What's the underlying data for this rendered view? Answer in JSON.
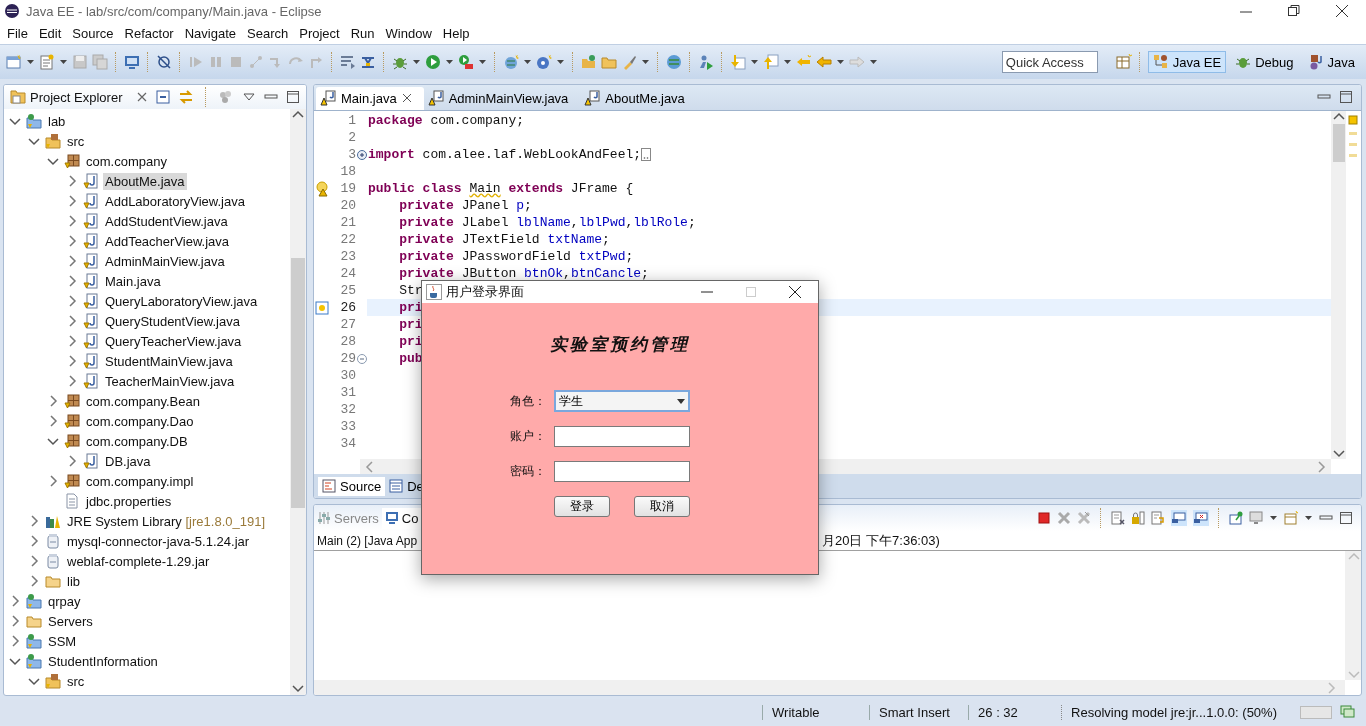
{
  "window": {
    "title": "Java EE - lab/src/com/company/Main.java - Eclipse"
  },
  "menu": [
    "File",
    "Edit",
    "Source",
    "Refactor",
    "Navigate",
    "Search",
    "Project",
    "Run",
    "Window",
    "Help"
  ],
  "toolbar": {
    "quick_access": {
      "placeholder": "Quick Access"
    },
    "perspectives": [
      {
        "label": "Java EE",
        "selected": true
      },
      {
        "label": "Debug",
        "selected": false
      },
      {
        "label": "Java",
        "selected": false
      }
    ]
  },
  "project_explorer": {
    "title": "Project Explorer",
    "tree": [
      {
        "label": "lab",
        "kind": "project",
        "expanded": true,
        "selected": false,
        "children": [
          {
            "label": "src",
            "kind": "src",
            "expanded": true,
            "selected": false,
            "children": [
              {
                "label": "com.company",
                "kind": "package",
                "expanded": true,
                "selected": false,
                "children": [
                  {
                    "label": "AboutMe.java",
                    "kind": "java",
                    "expanded": false,
                    "selected": true
                  },
                  {
                    "label": "AddLaboratoryView.java",
                    "kind": "java",
                    "expanded": false,
                    "selected": false
                  },
                  {
                    "label": "AddStudentView.java",
                    "kind": "java",
                    "expanded": false,
                    "selected": false
                  },
                  {
                    "label": "AddTeacherView.java",
                    "kind": "java",
                    "expanded": false,
                    "selected": false
                  },
                  {
                    "label": "AdminMainView.java",
                    "kind": "java",
                    "expanded": false,
                    "selected": false
                  },
                  {
                    "label": "Main.java",
                    "kind": "java",
                    "expanded": false,
                    "selected": false
                  },
                  {
                    "label": "QueryLaboratoryView.java",
                    "kind": "java",
                    "expanded": false,
                    "selected": false
                  },
                  {
                    "label": "QueryStudentView.java",
                    "kind": "java",
                    "expanded": false,
                    "selected": false
                  },
                  {
                    "label": "QueryTeacherView.java",
                    "kind": "java",
                    "expanded": false,
                    "selected": false
                  },
                  {
                    "label": "StudentMainView.java",
                    "kind": "java",
                    "expanded": false,
                    "selected": false
                  },
                  {
                    "label": "TeacherMainView.java",
                    "kind": "java",
                    "expanded": false,
                    "selected": false
                  }
                ]
              },
              {
                "label": "com.company.Bean",
                "kind": "package",
                "expanded": false,
                "selected": false
              },
              {
                "label": "com.company.Dao",
                "kind": "package",
                "expanded": false,
                "selected": false
              },
              {
                "label": "com.company.DB",
                "kind": "package",
                "expanded": true,
                "selected": false,
                "children": [
                  {
                    "label": "DB.java",
                    "kind": "java",
                    "expanded": false,
                    "selected": false
                  }
                ]
              },
              {
                "label": "com.company.impl",
                "kind": "package",
                "expanded": false,
                "selected": false
              },
              {
                "label": "jdbc.properties",
                "kind": "file",
                "selected": false
              }
            ]
          },
          {
            "label": "JRE System Library",
            "decoration": "[jre1.8.0_191]",
            "kind": "library",
            "expanded": false,
            "selected": false
          },
          {
            "label": "mysql-connector-java-5.1.24.jar",
            "kind": "jar",
            "expanded": false,
            "selected": false
          },
          {
            "label": "weblaf-complete-1.29.jar",
            "kind": "jar",
            "expanded": false,
            "selected": false
          },
          {
            "label": "lib",
            "kind": "folder",
            "expanded": false,
            "selected": false
          }
        ]
      },
      {
        "label": "qrpay",
        "kind": "project",
        "expanded": false,
        "selected": false
      },
      {
        "label": "Servers",
        "kind": "folder",
        "expanded": false,
        "selected": false
      },
      {
        "label": "SSM",
        "kind": "project",
        "expanded": false,
        "selected": false
      },
      {
        "label": "StudentInformation",
        "kind": "project",
        "expanded": true,
        "selected": false,
        "children": [
          {
            "label": "src",
            "kind": "src",
            "expanded": true,
            "selected": false
          }
        ]
      }
    ]
  },
  "editor": {
    "tabs": [
      {
        "label": "Main.java",
        "selected": true
      },
      {
        "label": "AdminMainView.java",
        "selected": false
      },
      {
        "label": "AboutMe.java",
        "selected": false
      }
    ],
    "lines": [
      {
        "number": "1",
        "current": false,
        "tokens": [
          {
            "kind": "keyword",
            "text": "package"
          },
          {
            "kind": "plain",
            "text": " com.company;"
          }
        ]
      },
      {
        "number": "2",
        "current": false
      },
      {
        "number": "3",
        "current": false,
        "folded": true,
        "tokens": [
          {
            "kind": "keyword",
            "text": "import"
          },
          {
            "kind": "plain",
            "text": " com.alee.laf.WebLookAndFeel;"
          }
        ]
      },
      {
        "number": "18",
        "current": false
      },
      {
        "number": "19",
        "current": false,
        "annotation": {
          "kind": "warning"
        },
        "tokens": [
          {
            "kind": "keyword",
            "text": "public"
          },
          {
            "kind": "keyword",
            "text": " class "
          },
          {
            "kind": "warning",
            "text": "Main"
          },
          {
            "kind": "keyword",
            "text": " extends"
          },
          {
            "kind": "plain",
            "text": " JFrame {"
          }
        ]
      },
      {
        "number": "20",
        "current": false,
        "tokens": [
          {
            "kind": "keyword",
            "text": "    private"
          },
          {
            "kind": "plain",
            "text": " JPanel "
          },
          {
            "kind": "field",
            "text": "p"
          },
          {
            "kind": "plain",
            "text": ";"
          }
        ]
      },
      {
        "number": "21",
        "current": false,
        "tokens": [
          {
            "kind": "keyword",
            "text": "    private"
          },
          {
            "kind": "plain",
            "text": " JLabel "
          },
          {
            "kind": "field",
            "text": "lblName"
          },
          {
            "kind": "plain",
            "text": ","
          },
          {
            "kind": "field",
            "text": "lblPwd"
          },
          {
            "kind": "plain",
            "text": ","
          },
          {
            "kind": "field",
            "text": "lblRole"
          },
          {
            "kind": "plain",
            "text": ";"
          }
        ]
      },
      {
        "number": "22",
        "current": false,
        "tokens": [
          {
            "kind": "keyword",
            "text": "    private"
          },
          {
            "kind": "plain",
            "text": " JTextField "
          },
          {
            "kind": "field",
            "text": "txtName"
          },
          {
            "kind": "plain",
            "text": ";"
          }
        ]
      },
      {
        "number": "23",
        "current": false,
        "tokens": [
          {
            "kind": "keyword",
            "text": "    private"
          },
          {
            "kind": "plain",
            "text": " JPasswordField "
          },
          {
            "kind": "field",
            "text": "txtPwd"
          },
          {
            "kind": "plain",
            "text": ";"
          }
        ]
      },
      {
        "number": "24",
        "current": false,
        "tokens": [
          {
            "kind": "keyword",
            "text": "    private"
          },
          {
            "kind": "plain",
            "text": " JButton "
          },
          {
            "kind": "field",
            "text": "btnOk"
          },
          {
            "kind": "plain",
            "text": ","
          },
          {
            "kind": "field",
            "text": "btnCancle"
          },
          {
            "kind": "plain",
            "text": ";"
          }
        ]
      },
      {
        "number": "25",
        "current": false,
        "tokens": [
          {
            "kind": "plain",
            "text": "    Str"
          }
        ]
      },
      {
        "number": "26",
        "current": true,
        "annotation": {
          "kind": "assist"
        },
        "tokens": [
          {
            "kind": "keyword",
            "text": "    pri"
          }
        ]
      },
      {
        "number": "27",
        "current": false,
        "tokens": [
          {
            "kind": "keyword",
            "text": "    pri"
          }
        ]
      },
      {
        "number": "28",
        "current": false,
        "tokens": [
          {
            "kind": "keyword",
            "text": "    pri"
          }
        ]
      },
      {
        "number": "29",
        "current": false,
        "folded": false,
        "tokens": [
          {
            "kind": "keyword",
            "text": "    pub"
          }
        ]
      },
      {
        "number": "30",
        "current": false
      },
      {
        "number": "31",
        "current": false
      },
      {
        "number": "32",
        "current": false
      },
      {
        "number": "33",
        "current": false
      },
      {
        "number": "34",
        "current": false
      }
    ],
    "bottom_tabs": [
      {
        "label": "Source",
        "selected": true
      },
      {
        "label": "De",
        "selected": false
      }
    ]
  },
  "console": {
    "tabs": [
      {
        "label": "Servers",
        "selected": false
      },
      {
        "label": "Co",
        "selected": true
      }
    ],
    "process_label": "Main (2) [Java App",
    "process_time": "月20日 下午7:36:03)"
  },
  "status_bar": {
    "mode": "Writable",
    "insert": "Smart Insert",
    "position": "26 : 32",
    "job": "Resolving model jre:jr...1.0.0: (50%)"
  },
  "dialog": {
    "title": "用户登录界面",
    "heading": "实验室预约管理",
    "fields": [
      {
        "label": "角色：",
        "kind": "select",
        "value": "学生"
      },
      {
        "label": "账户：",
        "kind": "text"
      },
      {
        "label": "密码：",
        "kind": "password"
      }
    ],
    "buttons": [
      "登录",
      "取消"
    ]
  }
}
